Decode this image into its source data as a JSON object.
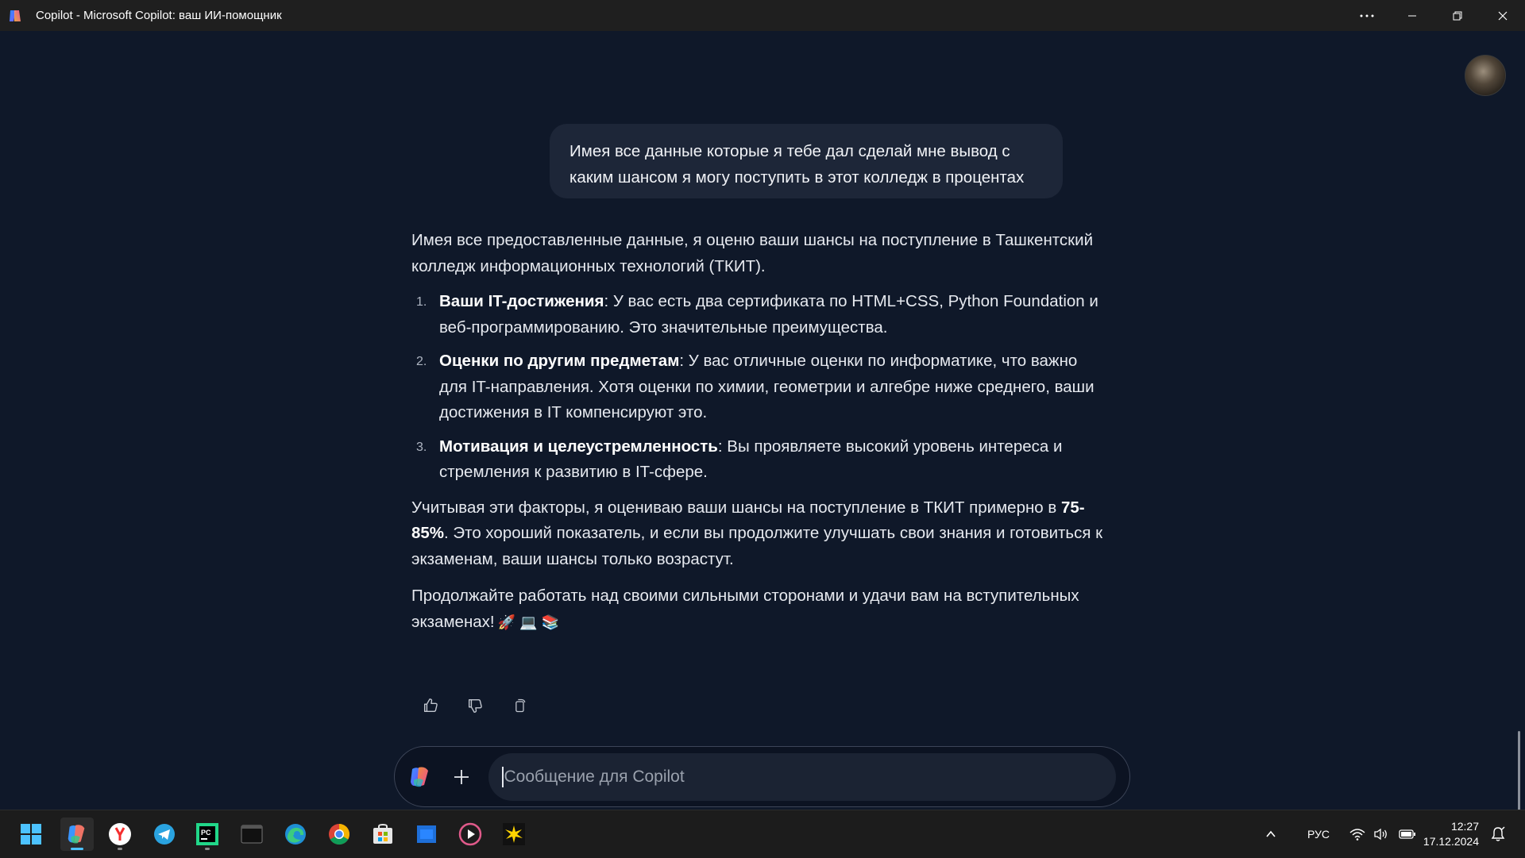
{
  "window": {
    "title": "Copilot - Microsoft Copilot: ваш ИИ-помощник",
    "icons": [
      "copilot-icon",
      "more-icon",
      "minimize-icon",
      "restore-icon",
      "close-icon"
    ]
  },
  "conversation": {
    "user_message": "Имея все данные которые я тебе дал сделай мне вывод с каким шансом я могу поступить в этот колледж в процентах",
    "answer": {
      "intro": "Имея все предоставленные данные, я оценю ваши шансы на поступление в Ташкентский колледж информационных технологий (ТКИТ).",
      "items": [
        {
          "number": "1.",
          "title": "Ваши IT-достижения",
          "text": ": У вас есть два сертификата по HTML+CSS, Python Foundation и веб-программированию. Это значительные преимущества."
        },
        {
          "number": "2.",
          "title": "Оценки по другим предметам",
          "text": ": У вас отличные оценки по информатике, что важно для IT-направления. Хотя оценки по химии, геометрии и алгебре ниже среднего, ваши достижения в IT компенсируют это."
        },
        {
          "number": "3.",
          "title": "Мотивация и целеустремленность",
          "text": ": Вы проявляете высокий уровень интереса и стремления к развитию в IT-сфере."
        }
      ],
      "conclusion_before": "Учитывая эти факторы, я оцениваю ваши шансы на поступление в ТКИТ примерно в ",
      "conclusion_bold": "75-85%",
      "conclusion_after": ". Это хороший показатель, и если вы продолжите улучшать свои знания и готовиться к экзаменам, ваши шансы только возрастут.",
      "closing": "Продолжайте работать над своими сильными сторонами и удачи вам на вступительных экзаменах!",
      "emojis": "🚀 💻 📚"
    },
    "actions": [
      "thumbs-up-icon",
      "thumbs-down-icon",
      "copy-icon"
    ]
  },
  "composer": {
    "placeholder": "Сообщение для Copilot"
  },
  "taskbar": {
    "apps": [
      "windows-start",
      "copilot",
      "yandex-browser",
      "telegram",
      "pycharm",
      "terminal",
      "edge",
      "chrome",
      "microsoft-store",
      "file-manager",
      "media-player",
      "sketch-app"
    ],
    "active_app": "copilot",
    "language": "РУС",
    "time": "12:27",
    "date": "17.12.2024"
  },
  "colors": {
    "background": "#0f1829",
    "user_bubble": "#1d2638",
    "taskbar": "#1c1c1c",
    "accent": "#4cc2ff"
  }
}
